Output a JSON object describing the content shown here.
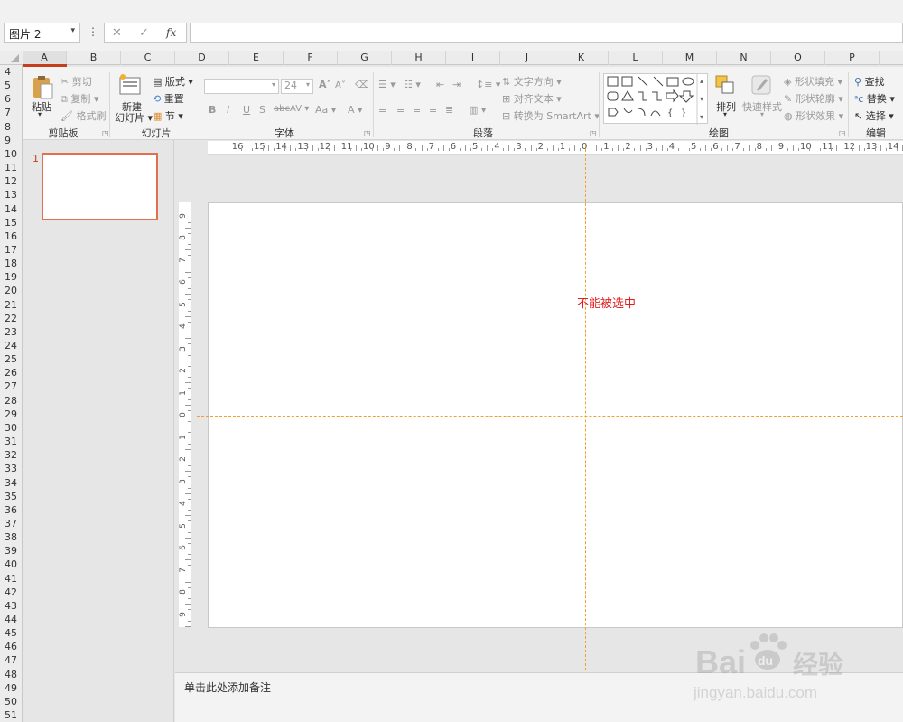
{
  "formula_bar": {
    "name_box": "图片 2",
    "dots": "⋮",
    "cancel": "✕",
    "enter": "✓",
    "fx": "fx",
    "formula": ""
  },
  "columns": [
    "A",
    "B",
    "C",
    "D",
    "E",
    "F",
    "G",
    "H",
    "I",
    "J",
    "K",
    "L",
    "M",
    "N",
    "O",
    "P"
  ],
  "rows": [
    "4",
    "5",
    "6",
    "7",
    "8",
    "9",
    "10",
    "11",
    "12",
    "13",
    "14",
    "15",
    "16",
    "17",
    "18",
    "19",
    "20",
    "21",
    "22",
    "23",
    "24",
    "25",
    "26",
    "27",
    "28",
    "29",
    "30",
    "31",
    "32",
    "33",
    "34",
    "35",
    "36",
    "37",
    "38",
    "39",
    "40",
    "41",
    "42",
    "43",
    "44",
    "45",
    "46",
    "47",
    "48",
    "49",
    "50",
    "51"
  ],
  "ribbon": {
    "clipboard": {
      "label": "剪贴板",
      "paste": "粘贴",
      "cut": "剪切",
      "copy": "复制",
      "format_painter": "格式刷"
    },
    "slides": {
      "label": "幻灯片",
      "new_slide_1": "新建",
      "new_slide_2": "幻灯片",
      "layout": "版式",
      "reset": "重置",
      "section": "节"
    },
    "font": {
      "label": "字体",
      "font_name": "",
      "font_size": "24",
      "bold": "B",
      "italic": "I",
      "underline": "U",
      "shadow": "S",
      "strike": "abc",
      "spacing": "AV",
      "case": "Aa",
      "color": "A",
      "grow": "A",
      "shrink": "A"
    },
    "paragraph": {
      "label": "段落",
      "text_direction": "文字方向",
      "align_text": "对齐文本",
      "smartart": "转换为 SmartArt"
    },
    "drawing": {
      "label": "绘图",
      "arrange": "排列",
      "quick_styles": "快速样式",
      "shape_fill": "形状填充",
      "shape_outline": "形状轮廓",
      "shape_effects": "形状效果"
    },
    "editing": {
      "label": "编辑",
      "find": "查找",
      "replace": "替换",
      "select": "选择"
    }
  },
  "slides": [
    {
      "number": "1"
    }
  ],
  "ruler": {
    "h_ticks": [
      "16",
      "15",
      "14",
      "13",
      "12",
      "11",
      "10",
      "9",
      "8",
      "7",
      "6",
      "5",
      "4",
      "3",
      "2",
      "1",
      "0",
      "1",
      "2",
      "3",
      "4",
      "5",
      "6",
      "7",
      "8",
      "9",
      "10",
      "11",
      "12",
      "13",
      "14"
    ],
    "v_ticks": [
      "9",
      "8",
      "7",
      "6",
      "5",
      "4",
      "3",
      "2",
      "1",
      "0",
      "1",
      "2",
      "3",
      "4",
      "5",
      "6",
      "7",
      "8",
      "9"
    ]
  },
  "canvas": {
    "selected_text": "不能被选中"
  },
  "notes": {
    "placeholder": "单击此处添加备注"
  },
  "watermark": {
    "brand": "Bai",
    "brand2": "du",
    "brand_cn": "经验",
    "url": "jingyan.baidu.com"
  },
  "colors": {
    "accent": "#c43e1c",
    "guide": "#f0a030",
    "red_text": "#e02020"
  }
}
